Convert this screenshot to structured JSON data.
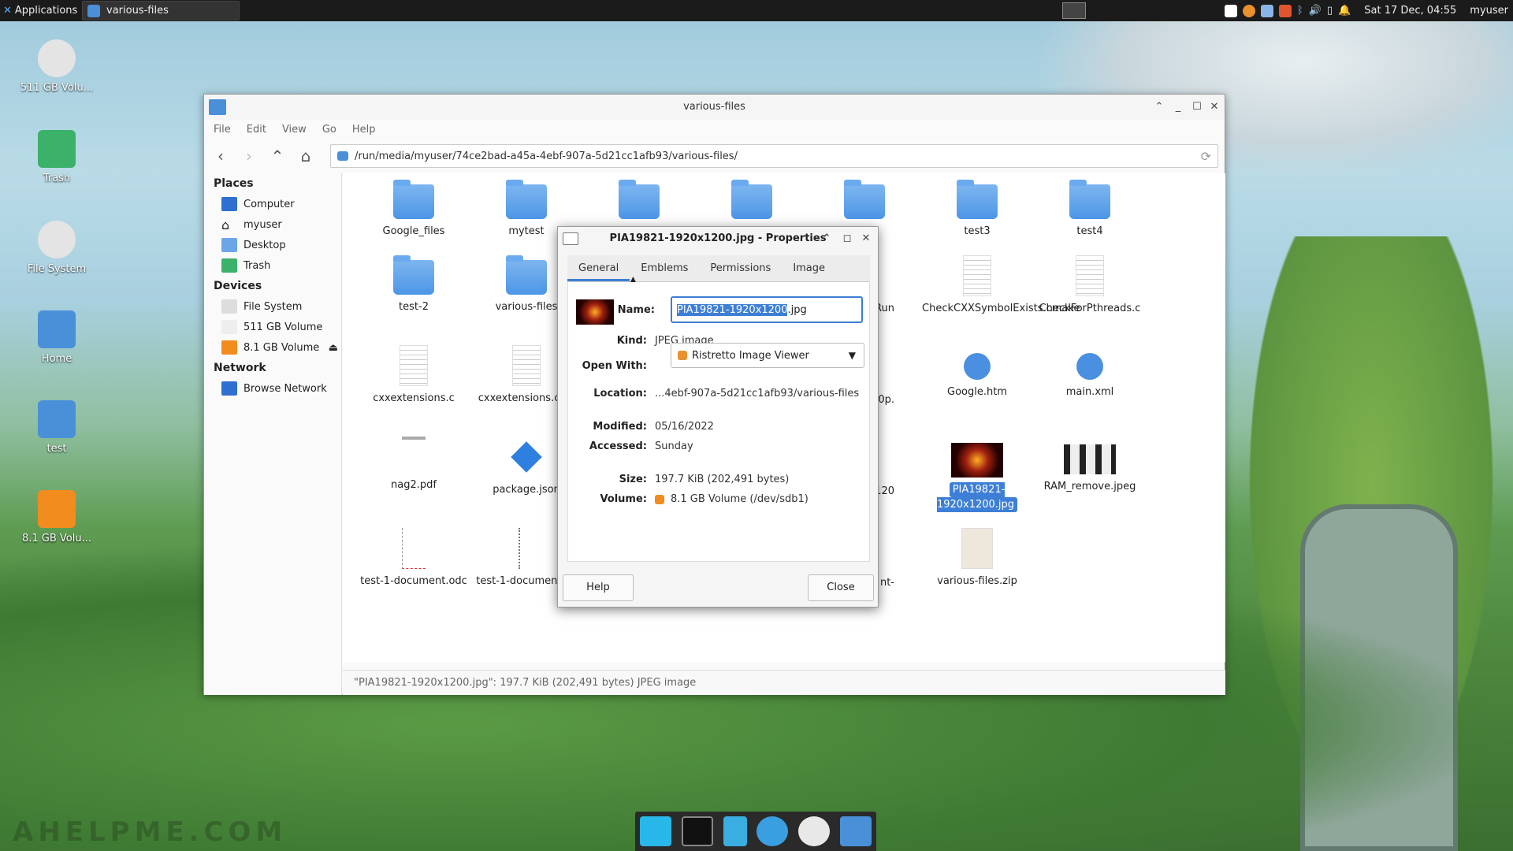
{
  "panel": {
    "applications": "Applications",
    "task_title": "various-files",
    "clock": "Sat 17 Dec, 04:55",
    "user": "myuser",
    "icon_colors": {
      "accent": "#3d7fd6",
      "orange": "#e8912d"
    }
  },
  "desktop": {
    "items": [
      {
        "label": "511 GB Volu...",
        "icon": "drive-icon"
      },
      {
        "label": "Trash",
        "icon": "trash-icon"
      },
      {
        "label": "File System",
        "icon": "drive-icon"
      },
      {
        "label": "Home",
        "icon": "home-folder-icon"
      },
      {
        "label": "test",
        "icon": "starred-folder-icon"
      },
      {
        "label": "8.1 GB Volu...",
        "icon": "usb-drive-icon"
      }
    ]
  },
  "fm": {
    "title": "various-files",
    "menu": [
      "File",
      "Edit",
      "View",
      "Go",
      "Help"
    ],
    "path": "/run/media/myuser/74ce2bad-a45a-4ebf-907a-5d21cc1afb93/various-files/",
    "sidebar": {
      "places_header": "Places",
      "places": [
        "Computer",
        "myuser",
        "Desktop",
        "Trash"
      ],
      "devices_header": "Devices",
      "devices": [
        "File System",
        "511 GB Volume",
        "8.1 GB Volume"
      ],
      "network_header": "Network",
      "network": [
        "Browse Network"
      ]
    },
    "files": [
      {
        "name": "Google_files",
        "kind": "folder"
      },
      {
        "name": "mytest",
        "kind": "folder"
      },
      {
        "name": "test3",
        "kind": "folder"
      },
      {
        "name": "test4",
        "kind": "folder"
      },
      {
        "name": "test-2",
        "kind": "folder"
      },
      {
        "name": "various-files",
        "kind": "folder"
      },
      {
        "name": "eRun",
        "kind": "partial"
      },
      {
        "name": "CheckCXXSymbolExists.cmake",
        "kind": "doc"
      },
      {
        "name": "CheckForPthreads.c",
        "kind": "doc"
      },
      {
        "name": "cxxextensions.c",
        "kind": "doc"
      },
      {
        "name": "cxxextensions.c.as",
        "kind": "doc"
      },
      {
        "name": "80p.",
        "kind": "partial"
      },
      {
        "name": "Google.htm",
        "kind": "web"
      },
      {
        "name": "main.xml",
        "kind": "web"
      },
      {
        "name": "nag2.pdf",
        "kind": "pdf"
      },
      {
        "name": "package.json",
        "kind": "json"
      },
      {
        "name": "x120",
        "kind": "partial"
      },
      {
        "name": "PIA19821-1920x1200.jpg",
        "kind": "image"
      },
      {
        "name": "RAM_remove.jpeg",
        "kind": "image2"
      },
      {
        "name": "test-1-document.odc",
        "kind": "chart"
      },
      {
        "name": "test-1-document.oc",
        "kind": "chart"
      },
      {
        "name": "nt-",
        "kind": "partial"
      },
      {
        "name": "various-files.zip",
        "kind": "zip"
      }
    ],
    "status": "\"PIA19821-1920x1200.jpg\": 197.7 KiB (202,491 bytes) JPEG image"
  },
  "dialog": {
    "title": "PIA19821-1920x1200.jpg - Properties",
    "tabs": [
      "General",
      "Emblems",
      "Permissions",
      "Image"
    ],
    "name_label": "Name:",
    "name_sel": "PIA19821-1920x1200",
    "name_rest": ".jpg",
    "kind_label": "Kind:",
    "kind": "JPEG image",
    "open_label": "Open With:",
    "open_with": "Ristretto Image Viewer",
    "loc_label": "Location:",
    "location": "...4ebf-907a-5d21cc1afb93/various-files",
    "mod_label": "Modified:",
    "modified": "05/16/2022",
    "acc_label": "Accessed:",
    "accessed": "Sunday",
    "size_label": "Size:",
    "size": "197.7 KiB (202,491 bytes)",
    "vol_label": "Volume:",
    "volume": "8.1 GB Volume (/dev/sdb1)",
    "help": "Help",
    "close": "Close"
  },
  "watermark": "AHELPME.COM"
}
